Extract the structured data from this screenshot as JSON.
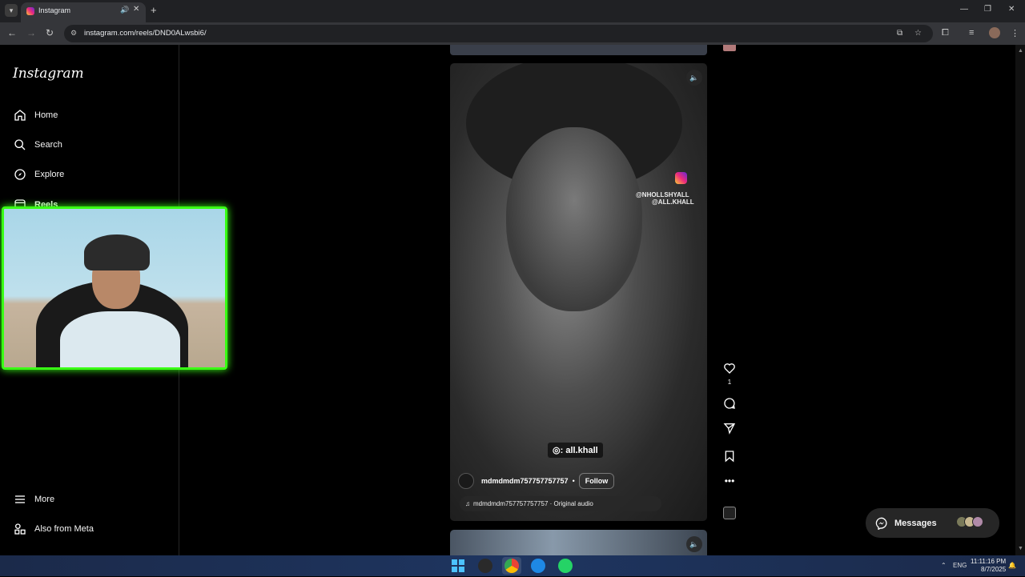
{
  "browser": {
    "tab_title": "Instagram",
    "url": "instagram.com/reels/DND0ALwsbi6/",
    "new_tab": "+",
    "controls": {
      "minimize": "—",
      "restore": "❐",
      "close": "✕"
    }
  },
  "sidebar": {
    "logo": "Instagram",
    "items": [
      {
        "label": "Home",
        "icon": "home-icon"
      },
      {
        "label": "Search",
        "icon": "search-icon"
      },
      {
        "label": "Explore",
        "icon": "compass-icon"
      },
      {
        "label": "Reels",
        "icon": "reels-icon"
      },
      {
        "label": "More",
        "icon": "menu-icon"
      },
      {
        "label": "Also from Meta",
        "icon": "meta-icon"
      }
    ]
  },
  "reel": {
    "overlay_handle_1": "@NHOLLSHYALL",
    "overlay_handle_2": "@ALL.KHALL",
    "watermark": ": all.khall",
    "author": "mdmdmdm757757757757",
    "separator": "•",
    "follow_label": "Follow",
    "audio_label": "mdmdmdm757757757757 · Original audio"
  },
  "actions": {
    "like_count": "1"
  },
  "messages": {
    "label": "Messages"
  },
  "taskbar": {
    "language": "ENG",
    "time": "11:11:16 PM",
    "date": "8/7/2025"
  },
  "colors": {
    "webcam_border": "#39ff14",
    "background": "#000000",
    "sidebar_border": "#262626"
  }
}
